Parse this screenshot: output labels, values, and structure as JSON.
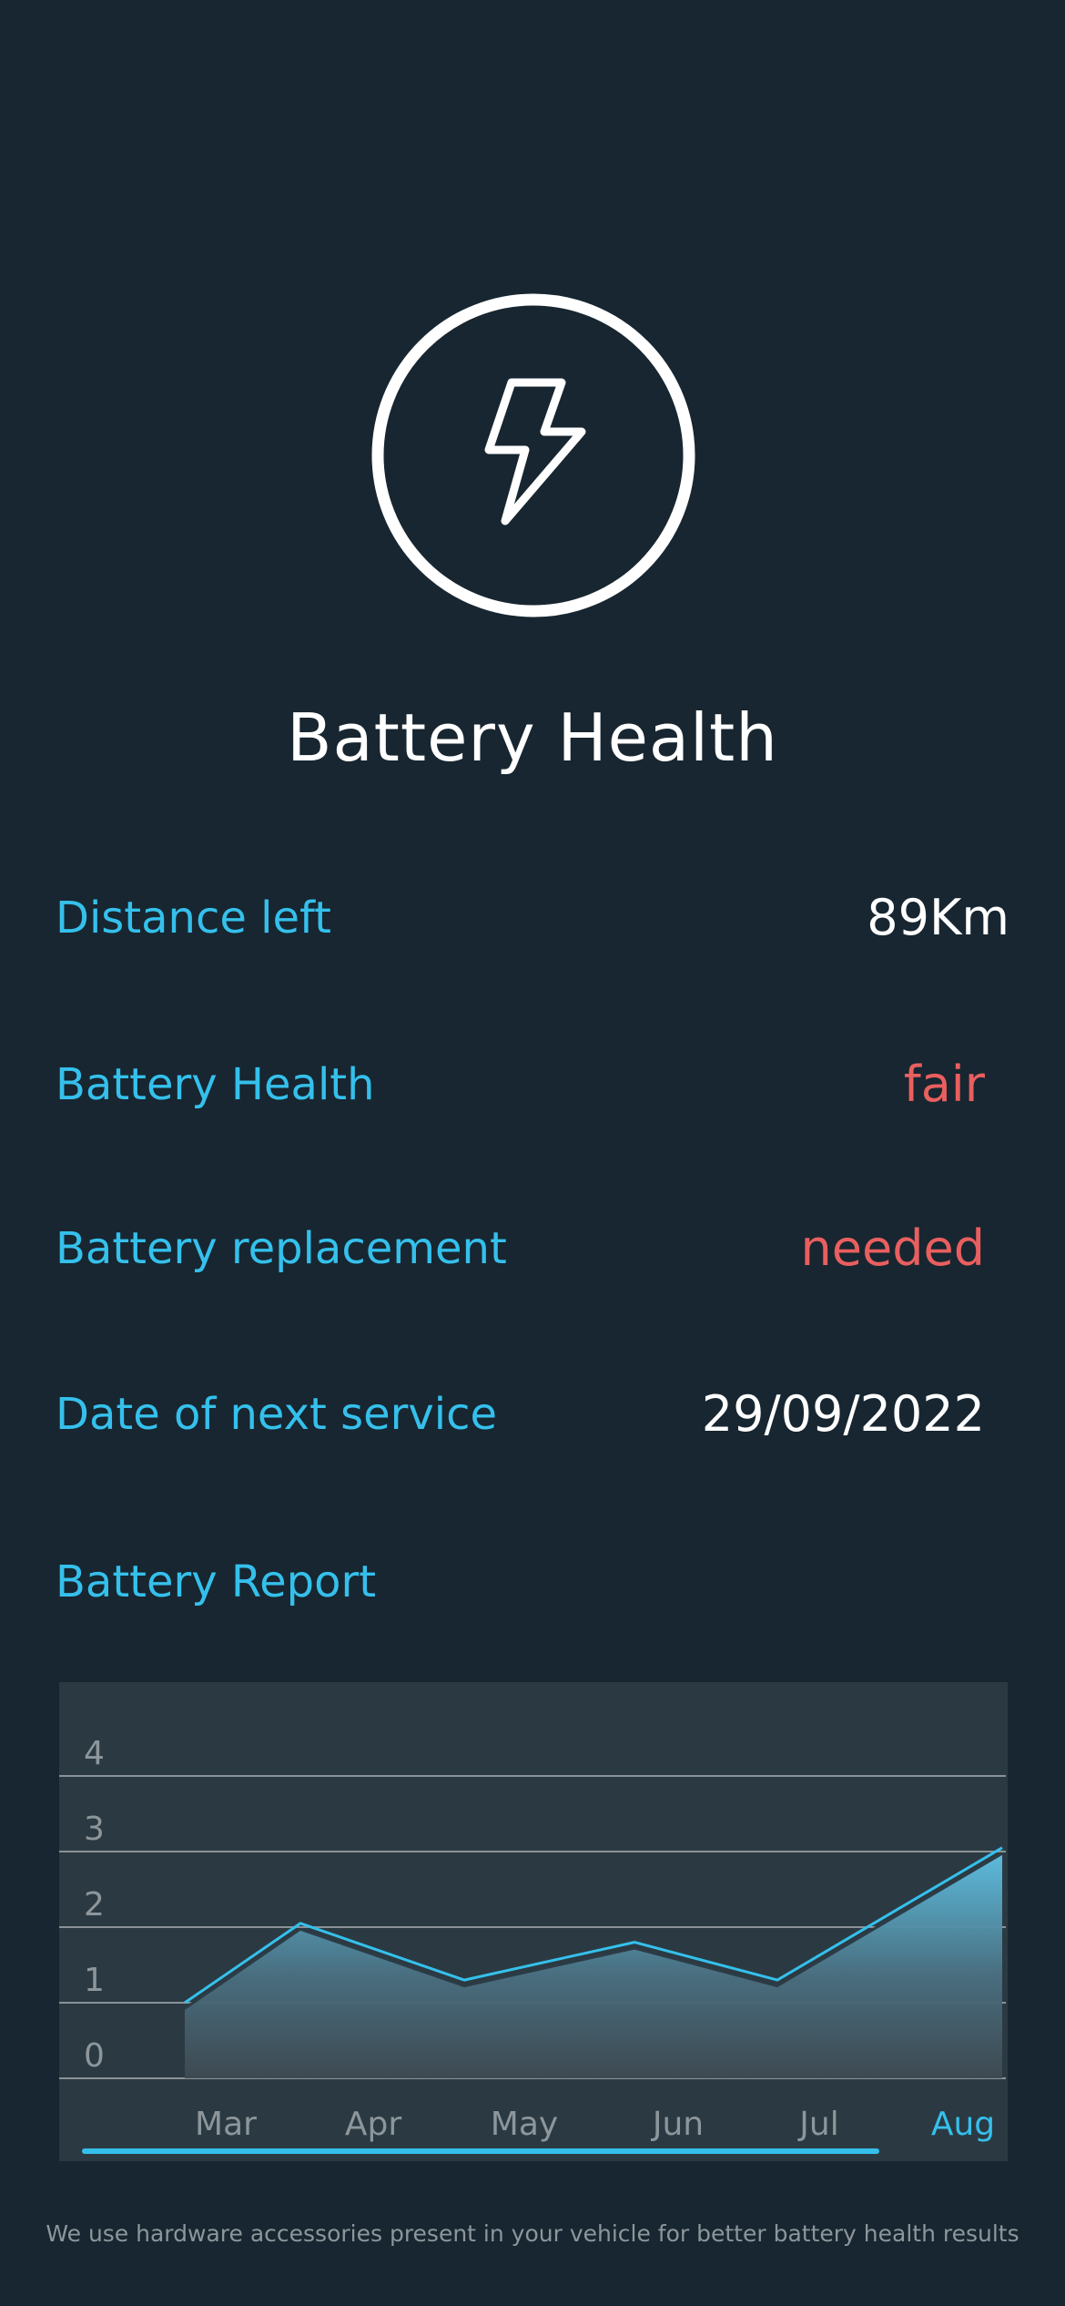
{
  "page": {
    "title": "Battery Health",
    "hero_icon": "lightning-bolt-icon",
    "footer_note": "We use hardware accessories present in your vehicle for better battery health results"
  },
  "stats": [
    {
      "label": "Distance left",
      "value": "89Km",
      "value_color": "#ffffff"
    },
    {
      "label": "Battery Health",
      "value": "fair",
      "value_color": "#e95f5f"
    },
    {
      "label": "Battery replacement",
      "value": "needed",
      "value_color": "#e95f5f"
    },
    {
      "label": "Date of next service",
      "value": "29/09/2022",
      "value_color": "#ffffff"
    }
  ],
  "report": {
    "title": "Battery Report"
  },
  "colors": {
    "background": "#172630",
    "accent": "#35c0ec",
    "warning": "#e95f5f",
    "card": "#2b3a42",
    "muted": "#8c969b"
  },
  "chart_data": {
    "type": "area",
    "x": [
      "Mar",
      "Apr",
      "May",
      "Jun",
      "Jul",
      "Aug"
    ],
    "series": [
      {
        "values": [
          1.0,
          2.05,
          1.3,
          1.8,
          1.3,
          3.05
        ]
      }
    ],
    "y_ticks": [
      0,
      1,
      2,
      3,
      4
    ],
    "ylim": [
      0,
      4
    ],
    "selected_x": "Aug",
    "grid": true,
    "title": "",
    "xlabel": "",
    "ylabel": ""
  }
}
